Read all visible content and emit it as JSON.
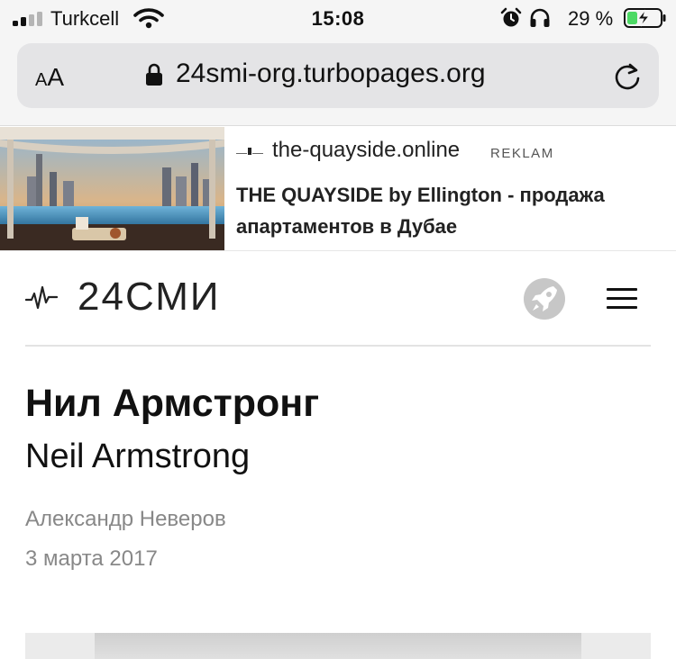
{
  "status_bar": {
    "carrier": "Turkcell",
    "time": "15:08",
    "battery_percent": "29 %",
    "icons": [
      "signal-icon",
      "wifi-icon",
      "alarm-icon",
      "headphones-icon",
      "battery-charging-icon"
    ]
  },
  "browser": {
    "text_size_small": "A",
    "text_size_large": "A",
    "url": "24smi-org.turbopages.org",
    "icons": [
      "lock-icon",
      "reload-icon"
    ]
  },
  "ad": {
    "domain": "the-quayside.online",
    "label": "REKLAM",
    "title": "THE QUAYSIDE by Ellington - продажа апартаментов в Дубае"
  },
  "site": {
    "brand": "24СМИ",
    "icons": [
      "pulse-logo-icon",
      "rocket-icon",
      "hamburger-menu-icon"
    ]
  },
  "article": {
    "title_ru": "Нил Армстронг",
    "title_en": "Neil Armstrong",
    "author": "Александр Неверов",
    "date": "3 марта 2017"
  },
  "colors": {
    "chrome_bg": "#f5f5f5",
    "urlbar_bg": "#e4e4e6",
    "meta_text": "#888888",
    "battery_green": "#4cd964"
  }
}
